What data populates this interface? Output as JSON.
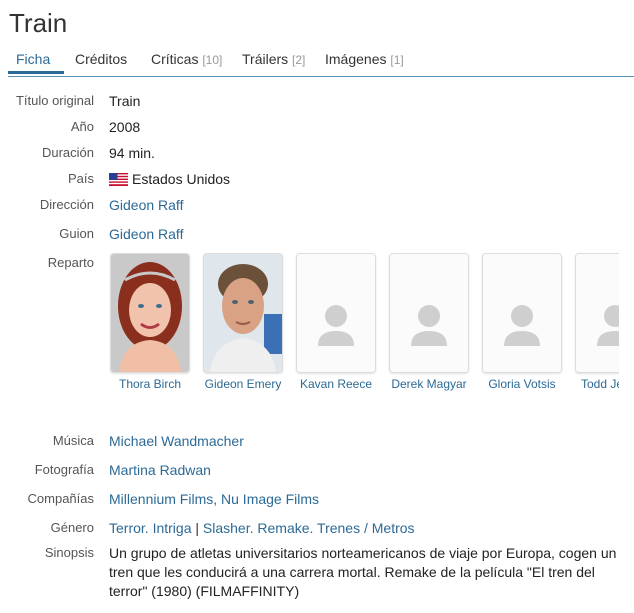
{
  "title": "Train",
  "tabs": [
    {
      "label": "Ficha",
      "count": ""
    },
    {
      "label": "Créditos",
      "count": ""
    },
    {
      "label": "Críticas",
      "count": "[10]"
    },
    {
      "label": "Tráilers",
      "count": "[2]"
    },
    {
      "label": "Imágenes",
      "count": "[1]"
    }
  ],
  "fields": {
    "original_title": {
      "label": "Título original",
      "value": "Train"
    },
    "year": {
      "label": "Año",
      "value": "2008"
    },
    "duration": {
      "label": "Duración",
      "value": "94 min."
    },
    "country": {
      "label": "País",
      "value": "Estados Unidos"
    },
    "director": {
      "label": "Dirección",
      "value": "Gideon Raff"
    },
    "writer": {
      "label": "Guion",
      "value": "Gideon Raff"
    },
    "cast_label": "Reparto",
    "music": {
      "label": "Música",
      "value": "Michael Wandmacher"
    },
    "photography": {
      "label": "Fotografía",
      "value": "Martina Radwan"
    },
    "companies": {
      "label": "Compañías",
      "value": "Millennium Films, Nu Image Films"
    },
    "genre": {
      "label": "Género",
      "value_1": "Terror. Intriga",
      "separator": "|",
      "value_2": "Slasher. Remake. Trenes / Metros"
    },
    "synopsis": {
      "label": "Sinopsis",
      "value": "Un grupo de atletas universitarios norteamericanos de viaje por Europa, cogen un tren que les conducirá a una carrera mortal. Remake de la película \"El tren del terror\" (1980) (FILMAFFINITY)"
    }
  },
  "cast": [
    {
      "name": "Thora Birch",
      "photo": "portrait"
    },
    {
      "name": "Gideon Emery",
      "photo": "portrait"
    },
    {
      "name": "Kavan Reece",
      "photo": "placeholder"
    },
    {
      "name": "Derek Magyar",
      "photo": "placeholder"
    },
    {
      "name": "Gloria Votsis",
      "photo": "placeholder"
    },
    {
      "name": "Todd Je",
      "photo": "placeholder"
    }
  ],
  "colors": {
    "link": "#2c6a96",
    "tab_line": "#5a8fb4"
  }
}
